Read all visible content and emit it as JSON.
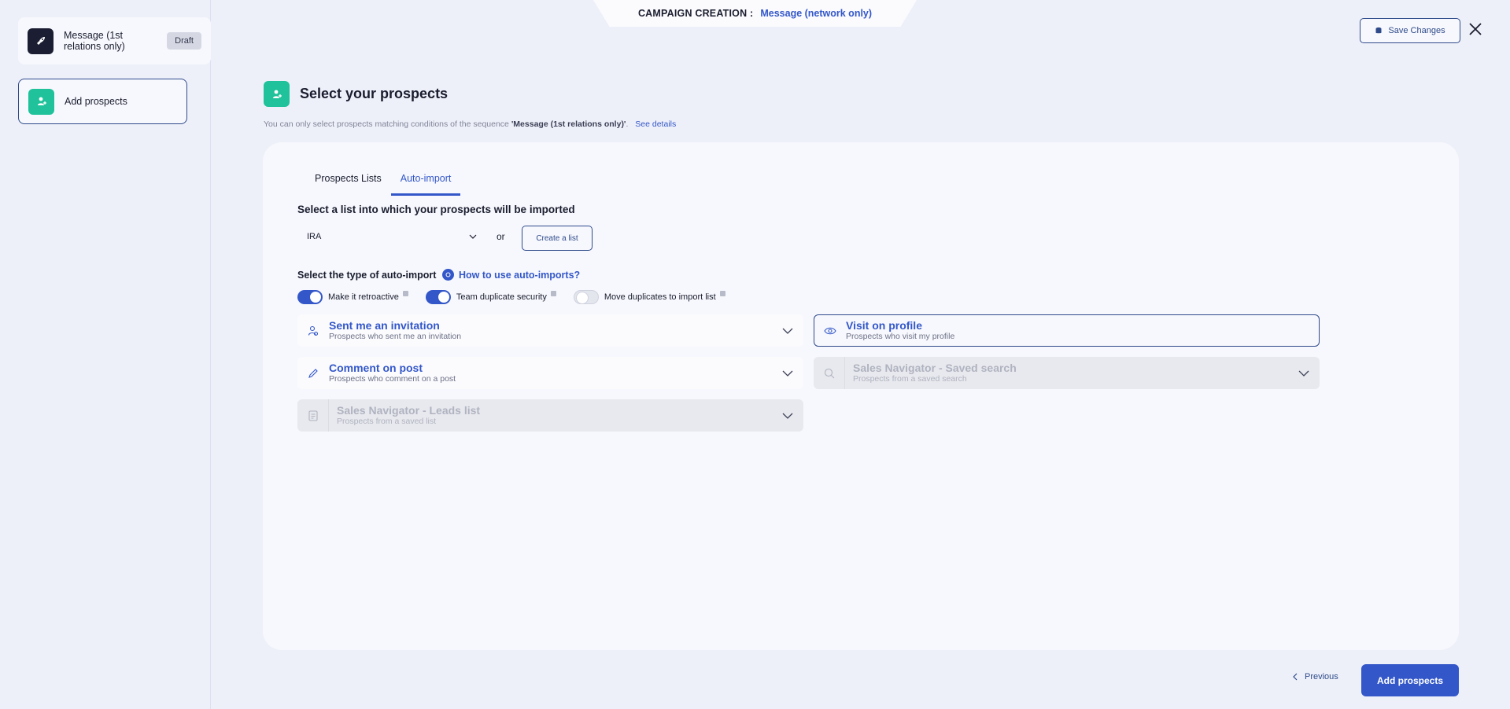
{
  "header": {
    "campaign_label": "CAMPAIGN CREATION :",
    "campaign_value": "Message (network only)",
    "save_label": "Save Changes"
  },
  "sidebar": {
    "sequence_name": "Message (1st relations only)",
    "status": "Draft",
    "step_label": "Add prospects"
  },
  "main": {
    "title": "Select your prospects",
    "subtitle_prefix": "You can only select prospects matching conditions of the sequence ",
    "subtitle_sequence": "'Message (1st relations only)'",
    "subtitle_suffix": ".",
    "see_details": "See details",
    "tabs": [
      {
        "label": "Prospects Lists",
        "active": false
      },
      {
        "label": "Auto-import",
        "active": true
      }
    ],
    "list_section_title": "Select a list into which your prospects will be imported",
    "list_value": "IRA",
    "or_text": "or",
    "create_list_label": "Create a list",
    "type_section_title": "Select the type of auto-import",
    "howto_label": "How to use auto-imports?",
    "toggles": [
      {
        "label": "Make it retroactive",
        "on": true
      },
      {
        "label": "Team duplicate security",
        "on": true
      },
      {
        "label": "Move duplicates to import list",
        "on": false
      }
    ],
    "import_types": [
      {
        "title": "Sent me an invitation",
        "desc": "Prospects who sent me an invitation",
        "icon": "user-invite-icon"
      },
      {
        "title": "Visit on profile",
        "desc": "Prospects who visit my profile",
        "icon": "eye-icon"
      },
      {
        "title": "Comment on post",
        "desc": "Prospects who comment on a post",
        "icon": "pencil-icon"
      },
      {
        "title": "Sales Navigator - Saved search",
        "desc": "Prospects from a saved search",
        "icon": "search-icon"
      },
      {
        "title": "Sales Navigator - Leads list",
        "desc": "Prospects from a saved list",
        "icon": "document-icon"
      }
    ]
  },
  "footer": {
    "previous_label": "Previous",
    "add_label": "Add prospects"
  },
  "colors": {
    "accent": "#3357c9",
    "green": "#1fc29a",
    "dark": "#1b1e32"
  }
}
